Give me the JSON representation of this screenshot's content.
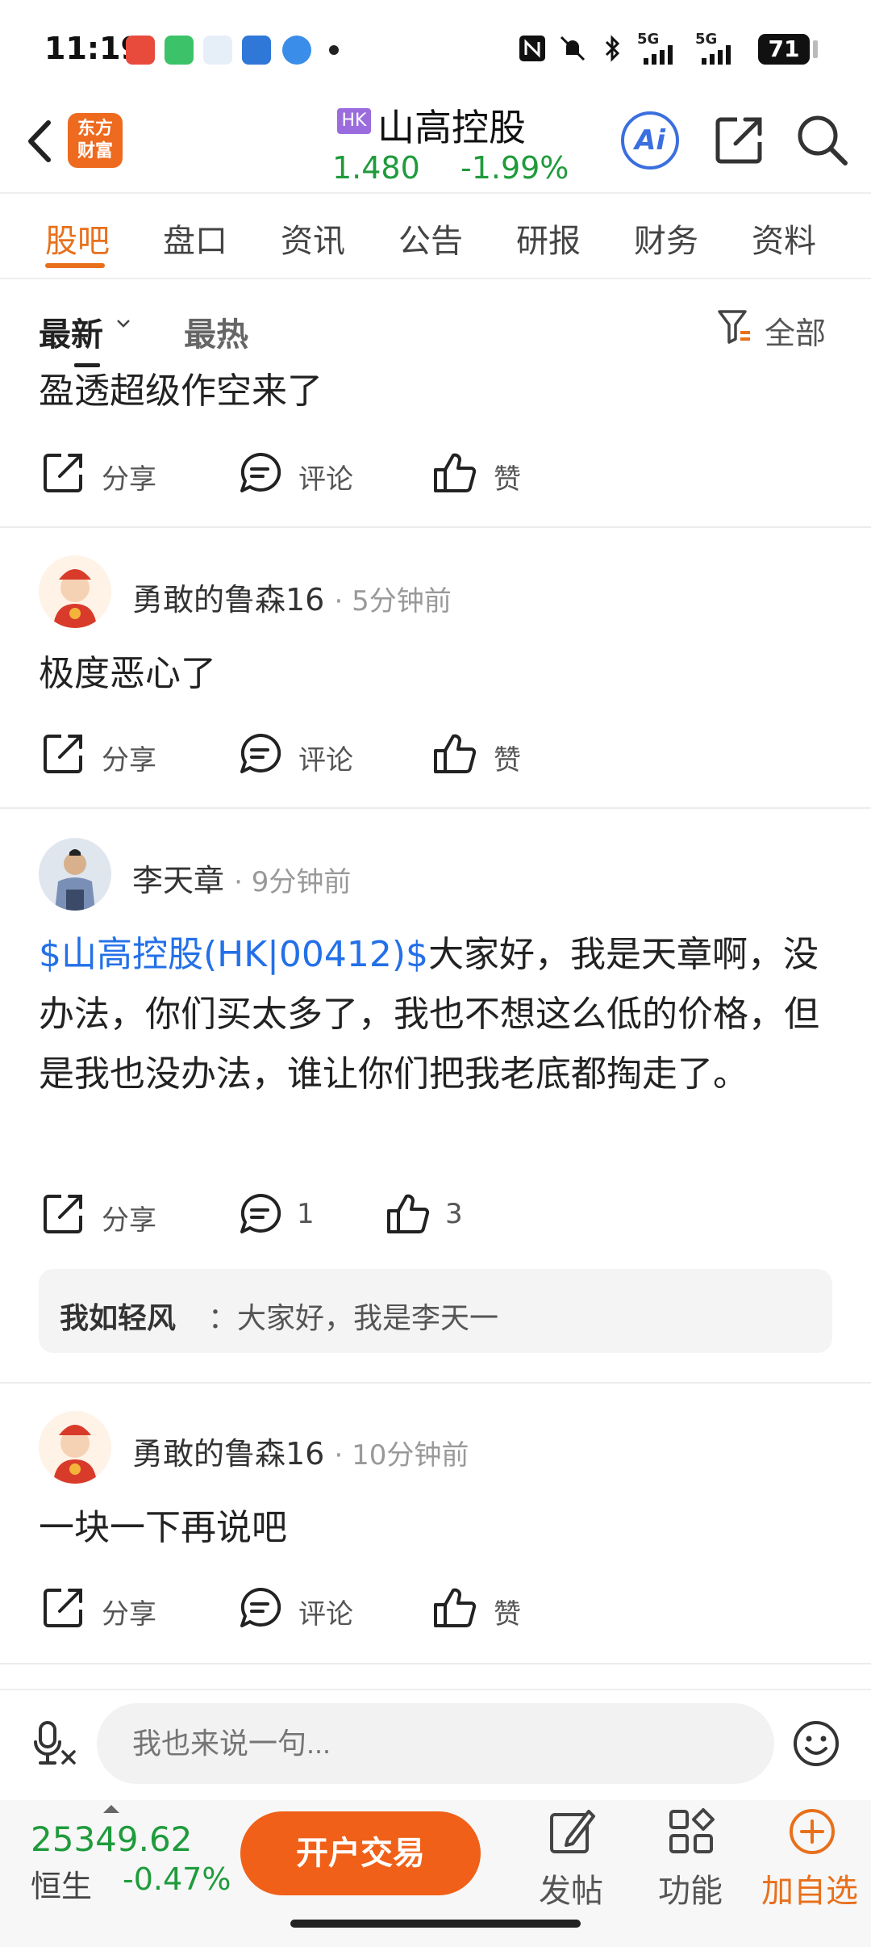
{
  "status_bar": {
    "time": "11:19",
    "battery": "71",
    "network_1": "5G",
    "network_2": "5G"
  },
  "header": {
    "logo_line1": "东方",
    "logo_line2": "财富",
    "market_badge": "HK",
    "stock_name": "山高控股",
    "price": "1.480",
    "change": "-1.99%",
    "ai_label": "Ai",
    "colors": {
      "accent": "#e8701b",
      "down": "#1f9b3c",
      "link": "#2370e8"
    }
  },
  "tabs": [
    {
      "label": "股吧",
      "active": true
    },
    {
      "label": "盘口"
    },
    {
      "label": "资讯"
    },
    {
      "label": "公告"
    },
    {
      "label": "研报"
    },
    {
      "label": "财务"
    },
    {
      "label": "资料"
    }
  ],
  "sort": {
    "newest": "最新",
    "hot": "最热",
    "filter": "全部"
  },
  "actions": {
    "share": "分享",
    "comment": "评论",
    "like": "赞"
  },
  "posts": [
    {
      "text": "盈透超级作空来了"
    },
    {
      "author": "勇敢的鲁森16",
      "time": "· 5分钟前",
      "text": "极度恶心了"
    },
    {
      "author": "李天章",
      "time": "· 9分钟前",
      "link": "$山高控股(HK|00412)$",
      "text": "大家好，我是天章啊，没办法，你们买太多了，我也不想这么低的价格，但是我也没办法，谁让你们把我老底都掏走了。",
      "comment_count": "1",
      "like_count": "3",
      "reply_user": "我如轻风",
      "reply_text": "：大家好，我是李天一"
    },
    {
      "author": "勇敢的鲁森16",
      "time": "· 10分钟前",
      "text": "一块一下再说吧"
    }
  ],
  "input": {
    "placeholder": "我也来说一句..."
  },
  "bottom": {
    "index_value": "25349.62",
    "index_name": "恒生",
    "index_change": "-0.47%",
    "trade_button": "开户交易",
    "post": "发帖",
    "functions": "功能",
    "add_watch": "加自选"
  }
}
